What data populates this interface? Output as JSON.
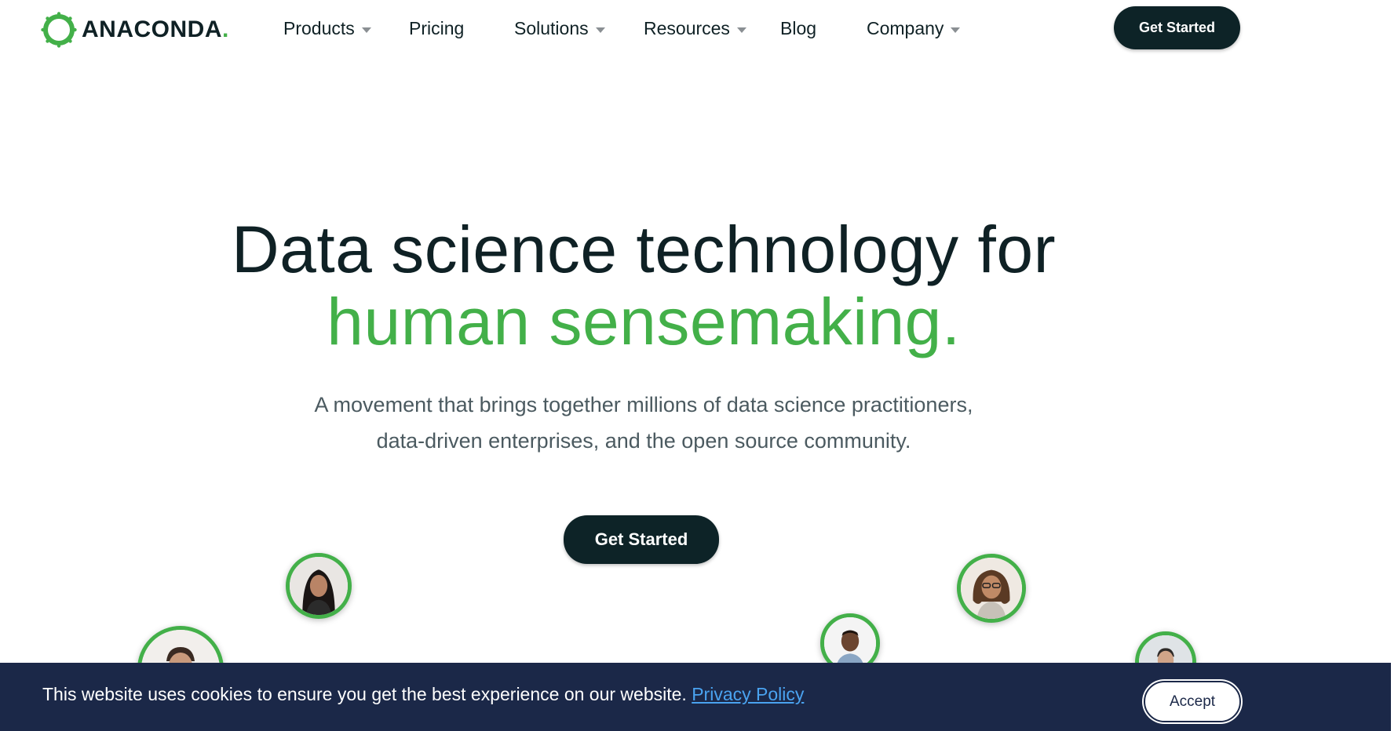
{
  "header": {
    "logo_text": "ANACONDA",
    "nav": {
      "products": "Products",
      "pricing": "Pricing",
      "solutions": "Solutions",
      "resources": "Resources",
      "blog": "Blog",
      "company": "Company"
    },
    "cta_label": "Get Started"
  },
  "hero": {
    "headline_line1": "Data science technology for",
    "headline_line2": "human sensemaking.",
    "subtitle_line1": "A movement that brings together millions of data science practitioners,",
    "subtitle_line2": "data-driven enterprises, and the open source community.",
    "cta_label": "Get Started"
  },
  "cookie_banner": {
    "message": "This website uses cookies to ensure you get the best experience on our website. ",
    "link_label": "Privacy Policy",
    "accept_label": "Accept"
  },
  "colors": {
    "brand_green": "#43b049",
    "dark_button": "#0d2327",
    "banner_bg": "#1b2848",
    "link_blue": "#4aa3f0"
  },
  "icons": {
    "logo": "anaconda-ring-logo",
    "dropdown": "caret-down-icon"
  }
}
